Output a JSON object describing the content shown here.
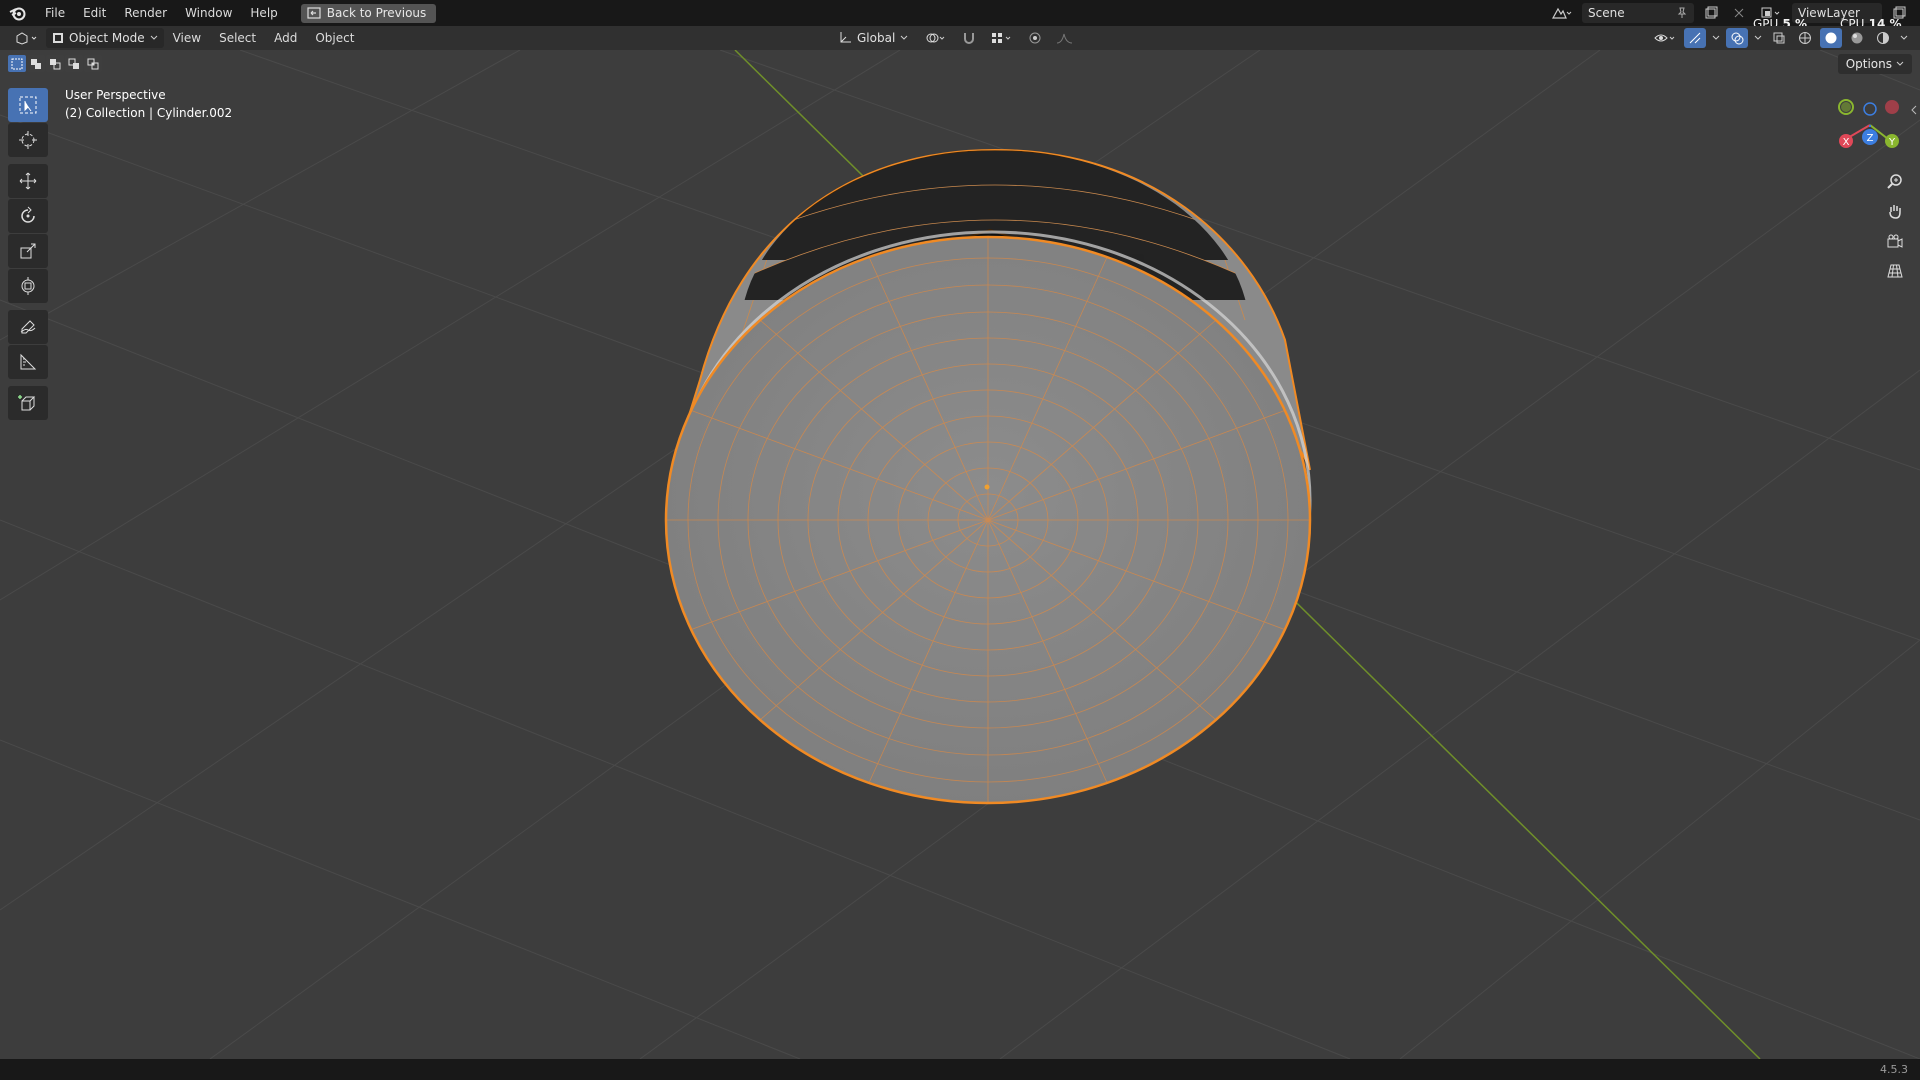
{
  "topbar": {
    "menus": [
      "File",
      "Edit",
      "Render",
      "Window",
      "Help"
    ],
    "back_button": "Back to Previous",
    "scene_name": "Scene",
    "view_layer": "ViewLayer"
  },
  "stats": {
    "gpu_label": "GPU",
    "gpu_value": "5 %",
    "cpu_label": "CPU",
    "cpu_value": "14 %"
  },
  "header": {
    "mode": "Object Mode",
    "menus": [
      "View",
      "Select",
      "Add",
      "Object"
    ],
    "transform_orientation": "Global",
    "options_label": "Options"
  },
  "viewport": {
    "view_name": "User Perspective",
    "collection_info": "(2) Collection | Cylinder.002"
  },
  "gizmo": {
    "x": "X",
    "y": "Y",
    "z": "Z"
  },
  "colors": {
    "selection_outline": "#f08a24",
    "active_tool": "#4772b3",
    "x_axis": "#e04858",
    "y_axis": "#8ab62f",
    "z_axis": "#3c7ee0"
  },
  "status": {
    "version": "4.5.3"
  }
}
